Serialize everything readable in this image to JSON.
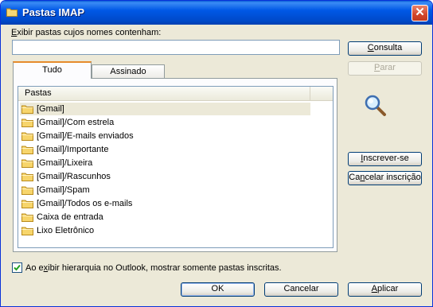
{
  "window": {
    "title": "Pastas IMAP",
    "close_glyph": "✕"
  },
  "filter": {
    "label_accel": "E",
    "label_rest": "xibir pastas cujos nomes contenham:",
    "value": ""
  },
  "buttons": {
    "consulta": {
      "accel": "C",
      "rest": "onsulta"
    },
    "parar": {
      "accel": "P",
      "rest": "arar"
    },
    "inscrever": {
      "accel": "I",
      "rest": "nscrever-se"
    },
    "cancelar_inscricao": {
      "pre": "Ca",
      "accel": "n",
      "rest": "celar inscrição"
    },
    "ok": "OK",
    "cancelar": "Cancelar",
    "aplicar": {
      "accel": "A",
      "rest": "plicar"
    }
  },
  "tabs": [
    {
      "label": "Tudo",
      "active": true
    },
    {
      "label": "Assinado",
      "active": false
    }
  ],
  "list": {
    "column_header": "Pastas",
    "folders": [
      "[Gmail]",
      "[Gmail]/Com estrela",
      "[Gmail]/E-mails enviados",
      "[Gmail]/Importante",
      "[Gmail]/Lixeira",
      "[Gmail]/Rascunhos",
      "[Gmail]/Spam",
      "[Gmail]/Todos os e-mails",
      "Caixa de entrada",
      "Lixo Eletrônico"
    ],
    "selected_index": 0
  },
  "option": {
    "pre": "Ao e",
    "accel": "x",
    "rest": "ibir hierarquia no Outlook, mostrar somente pastas inscritas.",
    "checked": true
  },
  "icons": {
    "title": "folder-icon",
    "search": "magnifier-icon",
    "row": "folder-icon"
  },
  "colors": {
    "titlebar": "#0058e6",
    "dialog": "#ece9d8",
    "tab_accent": "#e68b2c",
    "close": "#d2452a"
  }
}
